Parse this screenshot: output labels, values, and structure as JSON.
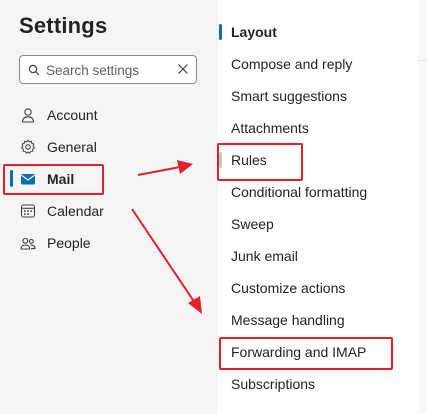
{
  "app": {
    "title": "Settings"
  },
  "search": {
    "placeholder": "Search settings",
    "value": ""
  },
  "sidebar": {
    "items": [
      {
        "label": "Account",
        "icon": "person-icon",
        "selected": false
      },
      {
        "label": "General",
        "icon": "gear-icon",
        "selected": false
      },
      {
        "label": "Mail",
        "icon": "mail-icon",
        "selected": true
      },
      {
        "label": "Calendar",
        "icon": "calendar-icon",
        "selected": false
      },
      {
        "label": "People",
        "icon": "people-icon",
        "selected": false
      }
    ]
  },
  "mail_settings": {
    "items": [
      {
        "label": "Layout",
        "selected": true
      },
      {
        "label": "Compose and reply",
        "selected": false
      },
      {
        "label": "Smart suggestions",
        "selected": false
      },
      {
        "label": "Attachments",
        "selected": false
      },
      {
        "label": "Rules",
        "selected": false
      },
      {
        "label": "Conditional formatting",
        "selected": false
      },
      {
        "label": "Sweep",
        "selected": false
      },
      {
        "label": "Junk email",
        "selected": false
      },
      {
        "label": "Customize actions",
        "selected": false
      },
      {
        "label": "Message handling",
        "selected": false
      },
      {
        "label": "Forwarding and IMAP",
        "selected": false
      },
      {
        "label": "Subscriptions",
        "selected": false
      }
    ]
  },
  "annotations": {
    "highlight_color": "#e2202b",
    "highlighted_items": [
      "Mail",
      "Rules",
      "Forwarding and IMAP"
    ]
  },
  "colors": {
    "accent": "#0f6cbd",
    "sidebar_bg": "#f5f5f5",
    "text": "#242424"
  }
}
